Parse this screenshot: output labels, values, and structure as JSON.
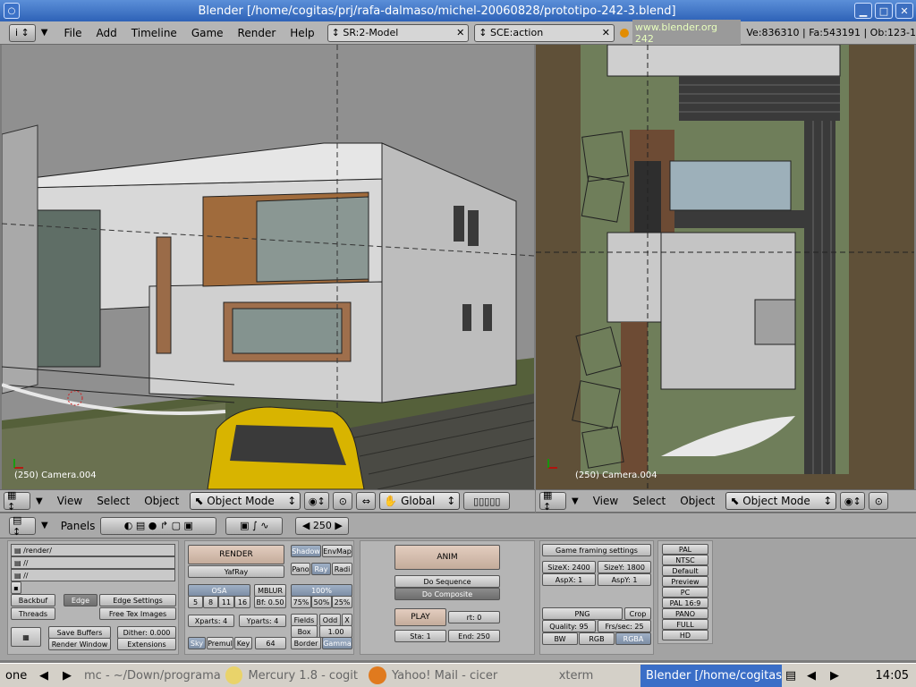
{
  "window": {
    "title": "Blender [/home/cogitas/prj/rafa-dalmaso/michel-20060828/prototipo-242-3.blend]",
    "controls": [
      "▁",
      "□",
      "✕"
    ]
  },
  "menubar": {
    "info_icon": "i",
    "menus": [
      "File",
      "Add",
      "Timeline",
      "Game",
      "Render",
      "Help"
    ],
    "screen_field": "SR:2-Model",
    "scene_field": "SCE:action",
    "url": "www.blender.org 242",
    "stats": "Ve:836310 | Fa:543191 | Ob:123-1"
  },
  "viewport_left": {
    "label": "(250) Camera.004",
    "header": {
      "menus": [
        "View",
        "Select",
        "Object"
      ],
      "mode": "Object Mode",
      "orientation": "Global"
    }
  },
  "viewport_right": {
    "label": "(250) Camera.004",
    "header": {
      "menus": [
        "View",
        "Select",
        "Object"
      ],
      "mode": "Object Mode"
    }
  },
  "buttons_header": {
    "panels_label": "Panels",
    "frame": "250"
  },
  "output_panel": {
    "paths": [
      "/render/",
      "//",
      "//"
    ],
    "backbuf": "Backbuf",
    "edge": "Edge",
    "edge_settings": "Edge Settings",
    "threads": "Threads",
    "free_tex": "Free Tex Images",
    "save_buffers": "Save Buffers",
    "dither": "Dither: 0.000",
    "render_window": "Render Window",
    "extensions": "Extensions"
  },
  "render_panel": {
    "render": "RENDER",
    "renderer": "YafRay",
    "shadow": "Shadow",
    "envmap": "EnvMap",
    "pano": "Pano",
    "ray": "Ray",
    "radi": "Radi",
    "osa": "OSA",
    "osa_values": [
      "5",
      "8",
      "11",
      "16"
    ],
    "mblur": "MBLUR",
    "bf": "Bf: 0.50",
    "percent": "100%",
    "percent_values": [
      "75%",
      "50%",
      "25%"
    ],
    "xparts": "Xparts: 4",
    "yparts": "Yparts: 4",
    "fields": "Fields",
    "odd": "Odd",
    "x": "X",
    "box": "Box",
    "box_value": "1.00",
    "sky": "Sky",
    "premul": "Premul",
    "key": "Key",
    "bits": "64",
    "border": "Border",
    "gamma": "Gamma"
  },
  "anim_panel": {
    "anim": "ANIM",
    "do_sequence": "Do Sequence",
    "do_composite": "Do Composite",
    "play": "PLAY",
    "rt": "rt: 0",
    "sta": "Sta: 1",
    "end": "End: 250"
  },
  "format_panel": {
    "game_framing": "Game framing settings",
    "sizex": "SizeX: 2400",
    "sizey": "SizeY: 1800",
    "aspx": "AspX: 1",
    "aspy": "AspY: 1",
    "format": "PNG",
    "crop": "Crop",
    "quality": "Quality: 95",
    "fps": "Frs/sec: 25",
    "bw": "BW",
    "rgb": "RGB",
    "rgba": "RGBA"
  },
  "presets": [
    "PAL",
    "NTSC",
    "Default",
    "Preview",
    "PC",
    "PAL 16:9",
    "PANO",
    "FULL",
    "HD"
  ],
  "taskbar": {
    "desktop": "one",
    "tasks": [
      "mc - ~/Down/programa",
      "Mercury 1.8 - cogit",
      "Yahoo! Mail - cicer",
      "xterm",
      "Blender [/home/cogitas"
    ],
    "clock": "14:05"
  }
}
